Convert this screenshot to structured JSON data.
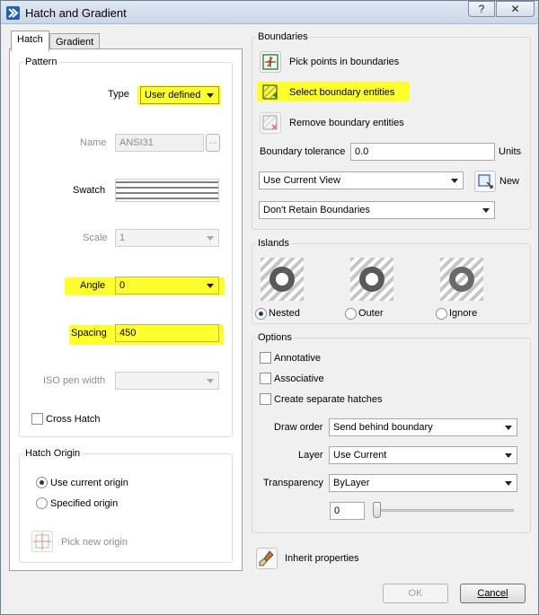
{
  "window": {
    "title": "Hatch and Gradient",
    "help_label": "?",
    "close_label": "✕"
  },
  "tabs": [
    {
      "label": "Hatch",
      "active": true
    },
    {
      "label": "Gradient",
      "active": false
    }
  ],
  "pattern": {
    "group_label": "Pattern",
    "type_label": "Type",
    "type_value": "User defined",
    "name_label": "Name",
    "name_value": "ANSI31",
    "browse_label": "...",
    "swatch_label": "Swatch",
    "scale_label": "Scale",
    "scale_value": "1",
    "angle_label": "Angle",
    "angle_value": "0",
    "spacing_label": "Spacing",
    "spacing_value": "450",
    "iso_label": "ISO pen width",
    "iso_value": "",
    "cross_hatch_label": "Cross Hatch"
  },
  "hatch_origin": {
    "group_label": "Hatch Origin",
    "use_current_label": "Use current origin",
    "specified_label": "Specified origin",
    "pick_new_label": "Pick new origin"
  },
  "boundaries": {
    "group_label": "Boundaries",
    "pick_points_label": "Pick points in boundaries",
    "select_entities_label": "Select boundary entities",
    "remove_entities_label": "Remove boundary entities",
    "tolerance_label": "Boundary tolerance",
    "tolerance_value": "0.0",
    "units_label": "Units",
    "view_value": "Use Current View",
    "new_label": "New",
    "retain_value": "Don't Retain Boundaries"
  },
  "islands": {
    "group_label": "Islands",
    "nested_label": "Nested",
    "outer_label": "Outer",
    "ignore_label": "Ignore"
  },
  "options": {
    "group_label": "Options",
    "annotative_label": "Annotative",
    "associative_label": "Associative",
    "separate_label": "Create separate hatches",
    "draw_order_label": "Draw order",
    "draw_order_value": "Send behind boundary",
    "layer_label": "Layer",
    "layer_value": "Use Current",
    "transparency_label": "Transparency",
    "transparency_value": "ByLayer",
    "transparency_amount": "0"
  },
  "inherit_label": "Inherit properties",
  "ok_label": "OK",
  "cancel_label": "Cancel",
  "colors": {
    "highlight": "#ffff2e",
    "titlebar": "#c9d7e8",
    "dialog_bg": "#f0f0f0"
  }
}
